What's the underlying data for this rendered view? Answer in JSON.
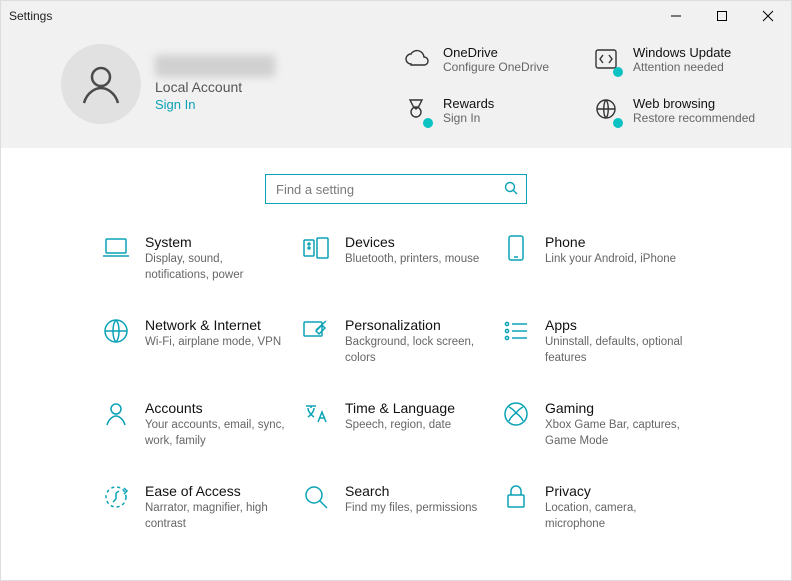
{
  "window": {
    "title": "Settings"
  },
  "user": {
    "account_type": "Local Account",
    "signin_label": "Sign In"
  },
  "header_tiles": {
    "onedrive": {
      "title": "OneDrive",
      "sub": "Configure OneDrive"
    },
    "update": {
      "title": "Windows Update",
      "sub": "Attention needed"
    },
    "rewards": {
      "title": "Rewards",
      "sub": "Sign In"
    },
    "web": {
      "title": "Web browsing",
      "sub": "Restore recommended"
    }
  },
  "search": {
    "placeholder": "Find a setting"
  },
  "categories": [
    {
      "id": "system",
      "title": "System",
      "sub": "Display, sound, notifications, power"
    },
    {
      "id": "devices",
      "title": "Devices",
      "sub": "Bluetooth, printers, mouse"
    },
    {
      "id": "phone",
      "title": "Phone",
      "sub": "Link your Android, iPhone"
    },
    {
      "id": "network",
      "title": "Network & Internet",
      "sub": "Wi-Fi, airplane mode, VPN"
    },
    {
      "id": "personal",
      "title": "Personalization",
      "sub": "Background, lock screen, colors"
    },
    {
      "id": "apps",
      "title": "Apps",
      "sub": "Uninstall, defaults, optional features"
    },
    {
      "id": "accounts",
      "title": "Accounts",
      "sub": "Your accounts, email, sync, work, family"
    },
    {
      "id": "time",
      "title": "Time & Language",
      "sub": "Speech, region, date"
    },
    {
      "id": "gaming",
      "title": "Gaming",
      "sub": "Xbox Game Bar, captures, Game Mode"
    },
    {
      "id": "ease",
      "title": "Ease of Access",
      "sub": "Narrator, magnifier, high contrast"
    },
    {
      "id": "search",
      "title": "Search",
      "sub": "Find my files, permissions"
    },
    {
      "id": "privacy",
      "title": "Privacy",
      "sub": "Location, camera, microphone"
    }
  ]
}
